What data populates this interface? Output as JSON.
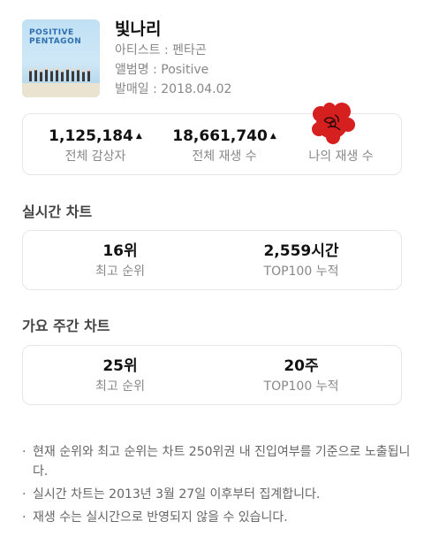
{
  "song": {
    "title": "빛나리",
    "artist": "아티스트 : 펜타곤",
    "album": "앨범명 : Positive",
    "release": "발매일 : 2018.04.02",
    "cover": {
      "line1": "POSITIVE",
      "line2": "PENTAGON"
    }
  },
  "stats": {
    "listeners": {
      "value": "1,125,184",
      "label": "전체 감상자"
    },
    "plays": {
      "value": "18,661,740",
      "label": "전체 재생 수"
    },
    "my_plays": {
      "value": "",
      "label": "나의 재생 수"
    },
    "trend_icon": "up-triangle"
  },
  "realtime_chart": {
    "title": "실시간 차트",
    "best_rank": {
      "value": "16위",
      "label": "최고 순위"
    },
    "top100": {
      "value": "2,559시간",
      "label": "TOP100 누적"
    }
  },
  "weekly_chart": {
    "title": "가요 주간 차트",
    "best_rank": {
      "value": "25위",
      "label": "최고 순위"
    },
    "top100": {
      "value": "20주",
      "label": "TOP100 누적"
    }
  },
  "notes": [
    "현재 순위와 최고 순위는 차트 250위권 내 진입여부를 기준으로 노출됩니다.",
    "실시간 차트는 2013년 3월 27일 이후부터 집계합니다.",
    "재생 수는 실시간으로 반영되지 않을 수 있습니다."
  ],
  "colors": {
    "seal": "#d61f1f",
    "muted": "#888888",
    "border": "#e6e6e6"
  }
}
